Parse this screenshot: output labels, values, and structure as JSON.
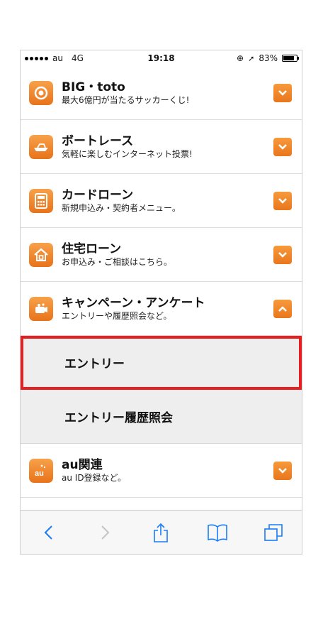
{
  "status_bar": {
    "carrier": "au",
    "network": "4G",
    "time": "19:18",
    "battery": "83%",
    "battery_level": 0.83
  },
  "menu": [
    {
      "title": "BIG・toto",
      "subtitle": "最大6億円が当たるサッカーくじ!",
      "icon": "target-icon",
      "expanded": false
    },
    {
      "title": "ボートレース",
      "subtitle": "気軽に楽しむインターネット投票!",
      "icon": "boat-icon",
      "expanded": false
    },
    {
      "title": "カードローン",
      "subtitle": "新規申込み・契約者メニュー。",
      "icon": "calculator-icon",
      "expanded": false
    },
    {
      "title": "住宅ローン",
      "subtitle": "お申込み・ご相談はこちら。",
      "icon": "house-icon",
      "expanded": false
    },
    {
      "title": "キャンペーン・アンケート",
      "subtitle": "エントリーや履歴照会など。",
      "icon": "campaign-icon",
      "expanded": true
    },
    {
      "title": "au関連",
      "subtitle": "au ID登録など。",
      "icon": "au-icon",
      "expanded": false
    }
  ],
  "campaign_submenu": [
    {
      "label": "エントリー"
    },
    {
      "label": "エントリー履歴照会"
    }
  ],
  "colors": {
    "accent": "#ee7f22",
    "highlight": "#e62020",
    "ios_blue": "#1a7cf5"
  },
  "toolbar_icons": [
    "back-icon",
    "forward-icon",
    "share-icon",
    "bookmarks-icon",
    "tabs-icon"
  ]
}
